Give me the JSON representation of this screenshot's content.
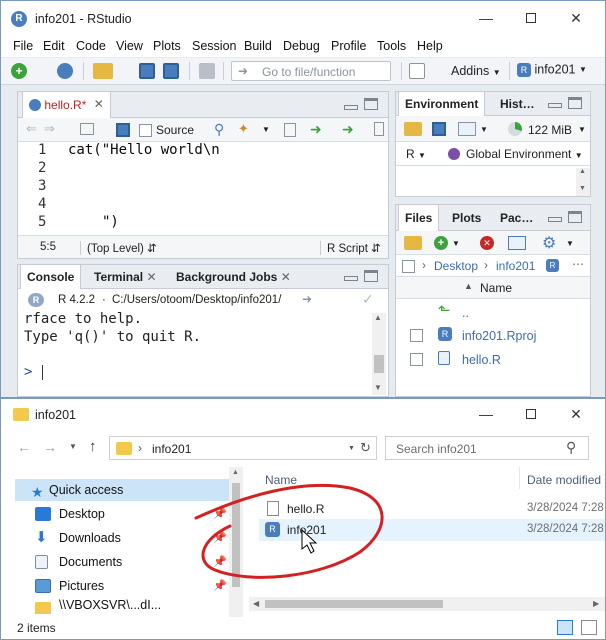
{
  "rstudio": {
    "title": "info201 - RStudio",
    "menu": [
      "File",
      "Edit",
      "Code",
      "View",
      "Plots",
      "Session",
      "Build",
      "Debug",
      "Profile",
      "Tools",
      "Help"
    ],
    "toolbar": {
      "goto_placeholder": "Go to file/function",
      "addins": "Addins",
      "project": "info201"
    },
    "editor": {
      "tab": "hello.R*",
      "source_label": "Source",
      "lines": [
        "1",
        "2",
        "3",
        "4",
        "5"
      ],
      "code_line1": "cat(\"Hello world\\n",
      "code_line5": "\")",
      "status_pos": "5:5",
      "status_scope": "(Top Level)",
      "status_type": "R Script"
    },
    "console": {
      "tabs": [
        "Console",
        "Terminal",
        "Background Jobs"
      ],
      "r_version": "R 4.2.2",
      "path": "C:/Users/otoom/Desktop/info201/",
      "output_line1": "rface to help.",
      "output_line2": "Type 'q()' to quit R.",
      "prompt": ">"
    },
    "environment": {
      "tabs": [
        "Environment",
        "History"
      ],
      "memory": "122 MiB",
      "lang": "R",
      "scope": "Global Environment"
    },
    "files": {
      "tabs": [
        "Files",
        "Plots",
        "Packag"
      ],
      "breadcrumb": [
        "Desktop",
        "info201"
      ],
      "column_name": "Name",
      "items": [
        "..",
        "info201.Rproj",
        "hello.R"
      ]
    }
  },
  "explorer": {
    "title": "info201",
    "address": "info201",
    "search_placeholder": "Search info201",
    "nav": [
      "Quick access",
      "Desktop",
      "Downloads",
      "Documents",
      "Pictures",
      "\\\\VBOXSVR\\...dI..."
    ],
    "columns": {
      "name": "Name",
      "date": "Date modified"
    },
    "files": [
      {
        "name": "hello.R",
        "date": "3/28/2024 7:28"
      },
      {
        "name": "info201",
        "date": "3/28/2024 7:28"
      }
    ],
    "status": "2 items"
  },
  "colors": {
    "rstudio_blue": "#4a7dbd",
    "annotation_red": "#d42020",
    "selection": "#cce4f7",
    "folder": "#f2c94c"
  }
}
